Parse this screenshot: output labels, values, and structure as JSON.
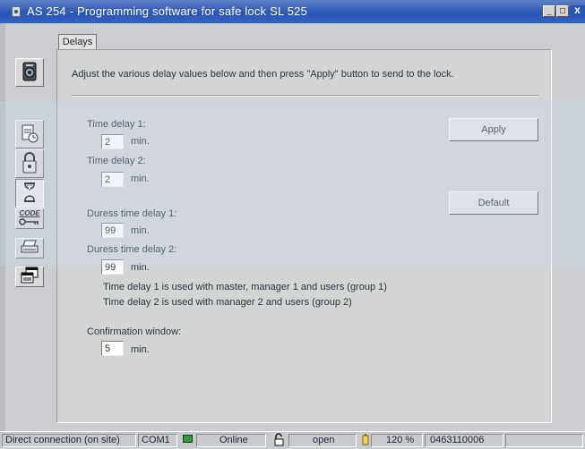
{
  "window": {
    "title": "AS 254 - Programming software for safe lock SL 525",
    "controls": {
      "minimize": "_",
      "maximize": "□",
      "close": "x"
    }
  },
  "tab": {
    "label": "Delays"
  },
  "sidebar": {
    "items": [
      {
        "name": "lock-settings",
        "icon": "lock-body-icon"
      },
      {
        "name": "user-times",
        "icon": "user-clock-icon"
      },
      {
        "name": "padlock",
        "icon": "padlock-icon"
      },
      {
        "name": "delays",
        "icon": "hourglass-icon",
        "selected": true
      },
      {
        "name": "code-key",
        "icon": "code-key-icon",
        "text": "CODE"
      },
      {
        "name": "print",
        "icon": "printer-icon"
      },
      {
        "name": "windows",
        "icon": "windows-stack-icon"
      }
    ]
  },
  "main": {
    "instruction": "Adjust the various delay values below and then press \"Apply\" button to send to the lock.",
    "unit": "min.",
    "time_delay_1": {
      "label": "Time delay 1:",
      "value": "2"
    },
    "time_delay_2": {
      "label": "Time delay 2:",
      "value": "2"
    },
    "duress_delay_1": {
      "label": "Duress time delay 1:",
      "value": "99"
    },
    "duress_delay_2": {
      "label": "Duress time delay 2:",
      "value": "99"
    },
    "note_1": "Time delay 1 is used with master, manager 1 and users (group 1)",
    "note_2": "Time delay 2 is used with manager 2 and users (group 2)",
    "confirmation": {
      "label": "Confirmation window:",
      "value": "5"
    },
    "apply_label": "Apply",
    "default_label": "Default"
  },
  "status": {
    "connection": "Direct connection (on site)",
    "port": "COM1",
    "online": "Online",
    "lock_state": "open",
    "zoom": "120 %",
    "serial": "0463110006",
    "led_color": "#2f9a3a"
  }
}
